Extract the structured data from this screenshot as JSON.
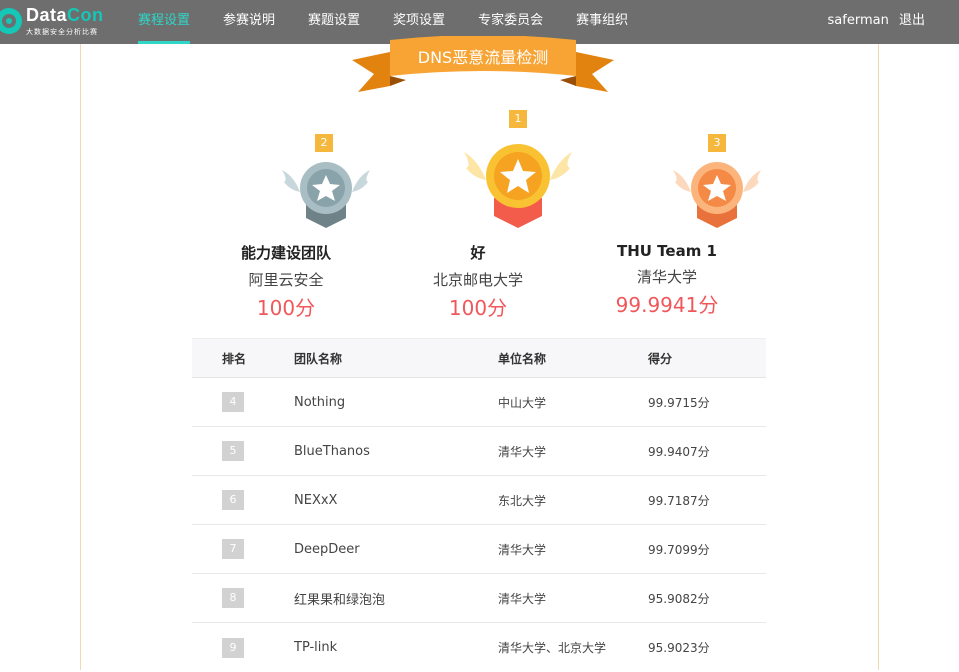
{
  "brand": {
    "title_prefix": "Data",
    "title_suffix": "Con",
    "subtitle": "大数据安全分析比赛"
  },
  "nav": {
    "items": [
      {
        "label": "赛程设置",
        "active": true
      },
      {
        "label": "参赛说明",
        "active": false
      },
      {
        "label": "赛题设置",
        "active": false
      },
      {
        "label": "奖项设置",
        "active": false
      },
      {
        "label": "专家委员会",
        "active": false
      },
      {
        "label": "赛事组织",
        "active": false
      }
    ]
  },
  "user": {
    "name": "saferman",
    "logout_label": "退出"
  },
  "competition": {
    "title": "DNS恶意流量检测"
  },
  "podium": {
    "first": {
      "rank": "1",
      "team": "好",
      "unit": "北京邮电大学",
      "score": "100分",
      "medal": "gold-medal-icon"
    },
    "second": {
      "rank": "2",
      "team": "能力建设团队",
      "unit": "阿里云安全",
      "score": "100分",
      "medal": "silver-medal-icon"
    },
    "third": {
      "rank": "3",
      "team": "THU Team 1",
      "unit": "清华大学",
      "score": "99.9941分",
      "medal": "bronze-medal-icon"
    }
  },
  "table": {
    "headers": {
      "rank": "排名",
      "team": "团队名称",
      "unit": "单位名称",
      "score": "得分"
    },
    "rows": [
      {
        "rank": "4",
        "team": "Nothing",
        "unit": "中山大学",
        "score": "99.9715分"
      },
      {
        "rank": "5",
        "team": "BlueThanos",
        "unit": "清华大学",
        "score": "99.9407分"
      },
      {
        "rank": "6",
        "team": "NEXxX",
        "unit": "东北大学",
        "score": "99.7187分"
      },
      {
        "rank": "7",
        "team": "DeepDeer",
        "unit": "清华大学",
        "score": "99.7099分"
      },
      {
        "rank": "8",
        "team": "红果果和绿泡泡",
        "unit": "清华大学",
        "score": "95.9082分"
      },
      {
        "rank": "9",
        "team": "TP-link",
        "unit": "清华大学、北京大学",
        "score": "95.9023分"
      }
    ]
  },
  "colors": {
    "topbar": "#6e6e6e",
    "accent": "#2fd6c6",
    "ribbon": "#f39a1e",
    "score": "#f0575a",
    "gold": "#f5b83d",
    "silver": "#9fb6bd",
    "bronze": "#f59a5a"
  }
}
